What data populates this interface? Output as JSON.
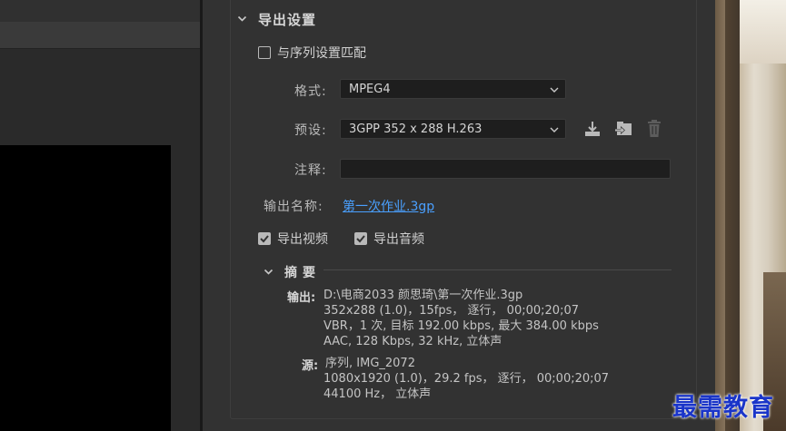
{
  "section": {
    "title": "导出设置"
  },
  "match_sequence": {
    "label": "与序列设置匹配",
    "checked": false
  },
  "format": {
    "label": "格式:",
    "value": "MPEG4"
  },
  "preset": {
    "label": "预设:",
    "value": "3GPP 352 x 288 H.263"
  },
  "comments": {
    "label": "注释:",
    "value": ""
  },
  "output_name": {
    "label": "输出名称:",
    "value": "第一次作业.3gp"
  },
  "export_video": {
    "label": "导出视频",
    "checked": true
  },
  "export_audio": {
    "label": "导出音频",
    "checked": true
  },
  "summary": {
    "title": "摘要",
    "output_label": "输出:",
    "output_lines": [
      "D:\\电商2033 颜思琦\\第一次作业.3gp",
      "352x288 (1.0)，15fps， 逐行， 00;00;20;07",
      "VBR，1 次, 目标 192.00 kbps, 最大 384.00 kbps",
      "AAC, 128 Kbps, 32  kHz, 立体声"
    ],
    "source_label": "源:",
    "source_lines": [
      "序列, IMG_2072",
      "1080x1920 (1.0)，29.2 fps， 逐行， 00;00;20;07",
      "44100 Hz， 立体声"
    ]
  },
  "watermark": "最需教育",
  "colors": {
    "link": "#4aa0ff",
    "panel_bg": "#323232",
    "field_bg": "#1e1e1e",
    "watermark": "#1a35c9"
  },
  "icons": [
    "chevron-down-icon",
    "save-preset-icon",
    "import-preset-icon",
    "delete-preset-icon"
  ]
}
